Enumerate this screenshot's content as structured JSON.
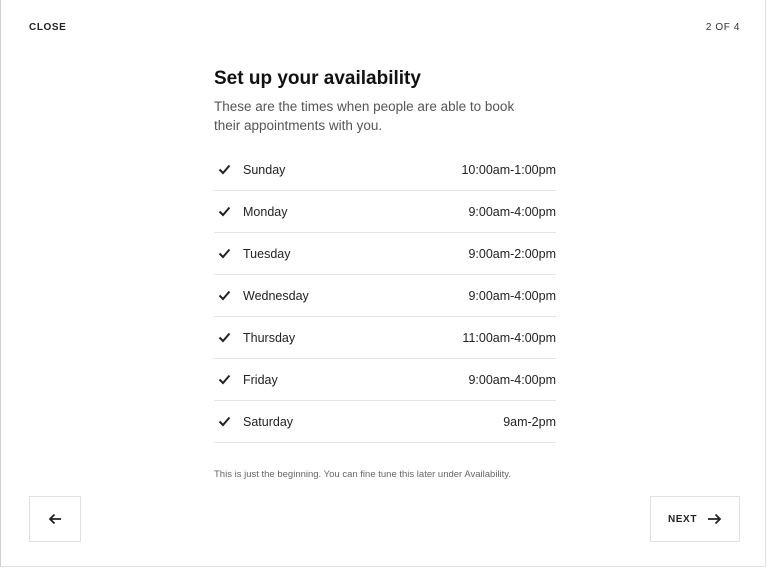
{
  "header": {
    "close_label": "CLOSE",
    "step_indicator": "2 OF 4"
  },
  "main": {
    "title": "Set up your availability",
    "subtitle": "These are the times when people are able to book their appointments with you.",
    "days": [
      {
        "day": "Sunday",
        "hours": "10:00am-1:00pm",
        "checked": true
      },
      {
        "day": "Monday",
        "hours": "9:00am-4:00pm",
        "checked": true
      },
      {
        "day": "Tuesday",
        "hours": "9:00am-2:00pm",
        "checked": true
      },
      {
        "day": "Wednesday",
        "hours": "9:00am-4:00pm",
        "checked": true
      },
      {
        "day": "Thursday",
        "hours": "11:00am-4:00pm",
        "checked": true
      },
      {
        "day": "Friday",
        "hours": "9:00am-4:00pm",
        "checked": true
      },
      {
        "day": "Saturday",
        "hours": "9am-2pm",
        "checked": true
      }
    ],
    "footnote": "This is just the beginning. You can fine tune this later under Availability."
  },
  "footer": {
    "back_icon": "arrow-left-icon",
    "next_label": "NEXT",
    "next_icon": "arrow-right-icon"
  }
}
